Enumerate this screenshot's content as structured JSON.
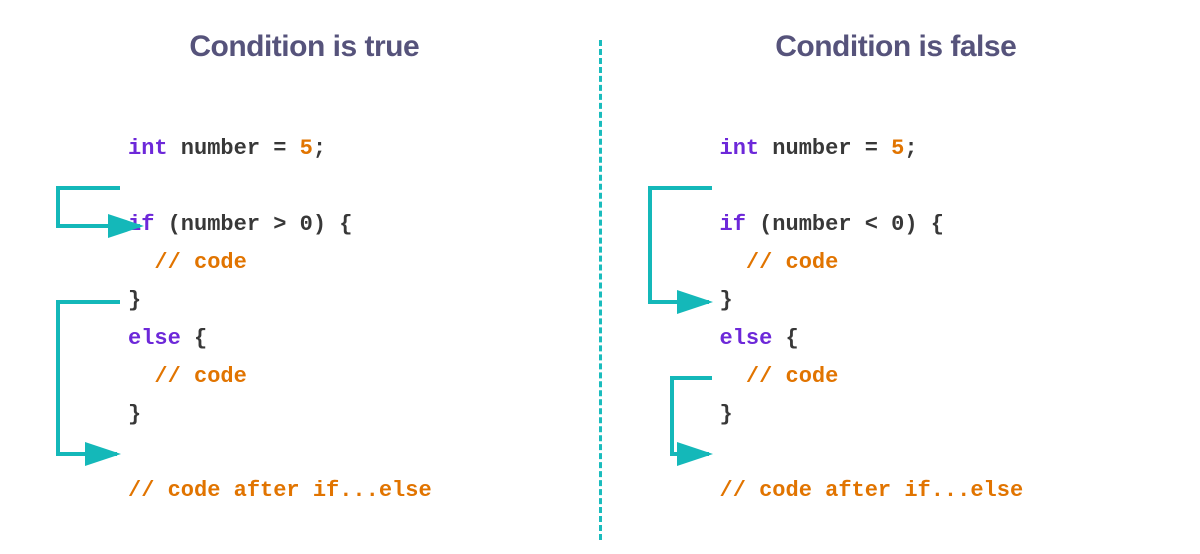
{
  "colors": {
    "title": "#56537b",
    "keyword": "#6d28d9",
    "text": "#383838",
    "accent": "#e17400",
    "arrow": "#14b8b9"
  },
  "left": {
    "title": "Condition is true",
    "l1_int": "int",
    "l1_rest": " number = ",
    "l1_num": "5",
    "l1_semi": ";",
    "l2_if": "if",
    "l2_rest": " (number > 0) {",
    "l3_com": "// code",
    "l4_brace": "}",
    "l5_else": "else",
    "l5_rest": " {",
    "l6_com": "// code",
    "l7_brace": "}",
    "l8_com": "// code after if...else"
  },
  "right": {
    "title": "Condition is false",
    "l1_int": "int",
    "l1_rest": " number = ",
    "l1_num": "5",
    "l1_semi": ";",
    "l2_if": "if",
    "l2_rest": " (number < 0) {",
    "l3_com": "// code",
    "l4_brace": "}",
    "l5_else": "else",
    "l5_rest": " {",
    "l6_com": "// code",
    "l7_brace": "}",
    "l8_com": "// code after if...else"
  }
}
